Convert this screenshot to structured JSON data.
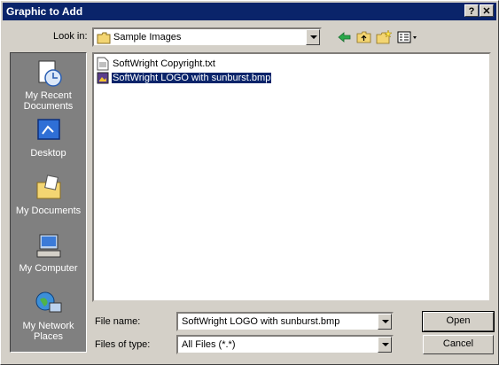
{
  "window": {
    "title": "Graphic to Add",
    "help_label": "?",
    "close_label": "✕"
  },
  "lookin": {
    "label": "Look in:",
    "value": "Sample Images"
  },
  "places": [
    {
      "label": "My Recent Documents"
    },
    {
      "label": "Desktop"
    },
    {
      "label": "My Documents"
    },
    {
      "label": "My Computer"
    },
    {
      "label": "My Network Places"
    }
  ],
  "files": [
    {
      "name": "SoftWright Copyright.txt",
      "icon": "text-file-icon",
      "selected": false
    },
    {
      "name": "SoftWright LOGO with sunburst.bmp",
      "icon": "bitmap-file-icon",
      "selected": true
    }
  ],
  "filename": {
    "label": "File name:",
    "value": "SoftWright LOGO with sunburst.bmp"
  },
  "filetype": {
    "label": "Files of type:",
    "value": "All Files (*.*)"
  },
  "buttons": {
    "open": "Open",
    "cancel": "Cancel"
  },
  "colors": {
    "titlebar": "#0a246a",
    "face": "#d4d0c8",
    "places_bg": "#808080",
    "selection": "#0a246a"
  }
}
